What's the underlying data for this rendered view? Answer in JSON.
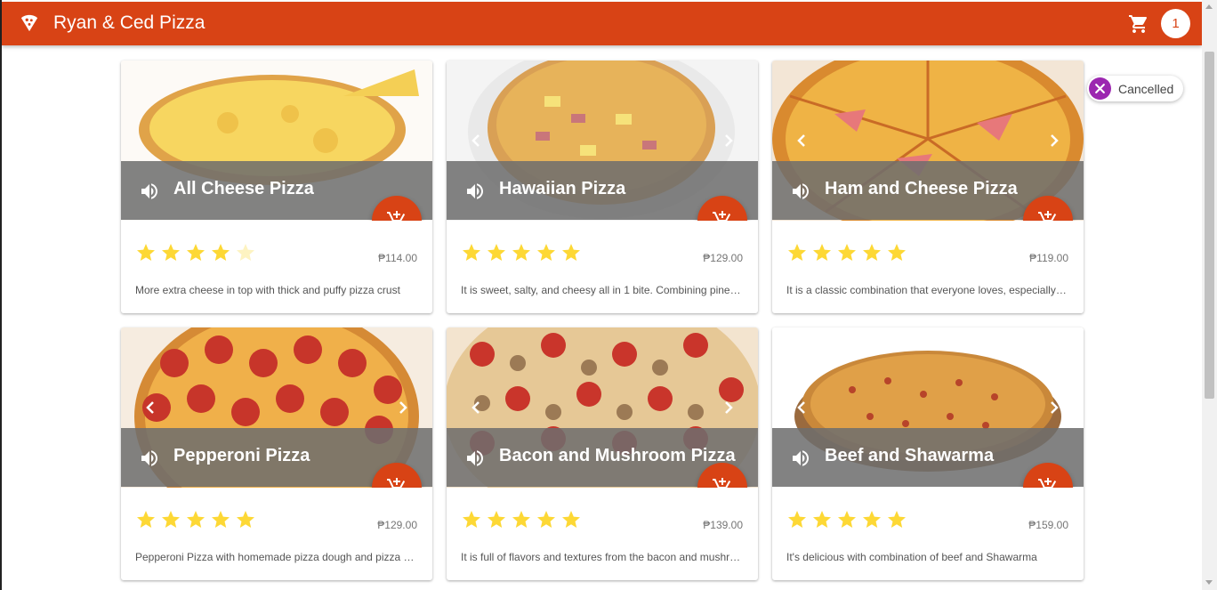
{
  "app": {
    "title": "Ryan & Ced Pizza",
    "logo": "pizza-slice-icon",
    "accent": "#d84315"
  },
  "cart": {
    "icon": "cart-icon",
    "count": "1"
  },
  "toast": {
    "icon": "cancel-icon",
    "text": "Cancelled",
    "color": "#9c27b0"
  },
  "products": [
    {
      "name": "All Cheese Pizza",
      "price": "₱114.00",
      "rating": 4,
      "description": "More extra cheese in top with thick and puffy pizza crust"
    },
    {
      "name": "Hawaiian Pizza",
      "price": "₱129.00",
      "rating": 5,
      "description": "It is sweet, salty, and cheesy all in 1 bite. Combining pineapple and ham"
    },
    {
      "name": "Ham and Cheese Pizza",
      "price": "₱119.00",
      "rating": 5,
      "description": "It is a classic combination that everyone loves, especially kids"
    },
    {
      "name": "Pepperoni Pizza",
      "price": "₱129.00",
      "rating": 5,
      "description": "Pepperoni Pizza with homemade pizza dough and pizza sauce"
    },
    {
      "name": "Bacon and Mushroom Pizza",
      "price": "₱139.00",
      "rating": 5,
      "description": "It is full of flavors and textures from the bacon and mushroom"
    },
    {
      "name": "Beef and Shawarma",
      "price": "₱159.00",
      "rating": 5,
      "description": "It's delicious with combination of beef and Shawarma"
    }
  ]
}
